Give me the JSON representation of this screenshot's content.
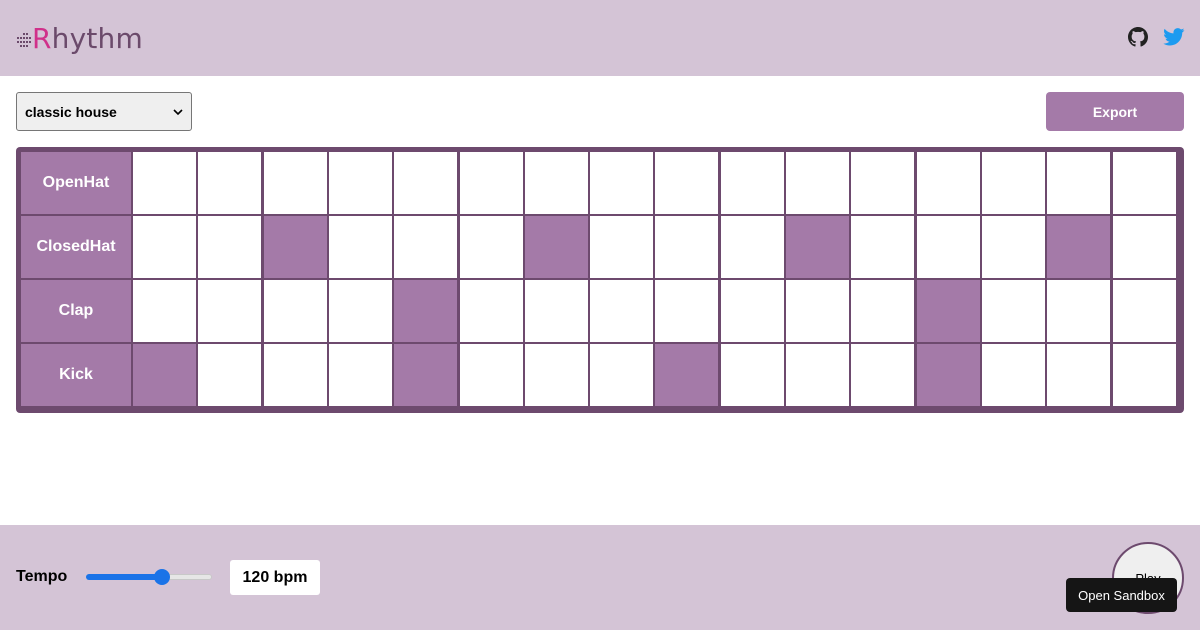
{
  "header": {
    "logo_initial": "R",
    "logo_rest": "hythm",
    "github_icon": "github-icon",
    "twitter_icon": "twitter-icon"
  },
  "toolbar": {
    "preset_selected": "classic house",
    "export_label": "Export"
  },
  "sequencer": {
    "steps": 16,
    "active_color": "#a47aa8",
    "rows": [
      {
        "label": "OpenHat",
        "pattern": [
          0,
          0,
          0,
          0,
          0,
          0,
          0,
          0,
          0,
          0,
          0,
          0,
          0,
          0,
          0,
          0
        ]
      },
      {
        "label": "ClosedHat",
        "pattern": [
          0,
          0,
          1,
          0,
          0,
          0,
          1,
          0,
          0,
          0,
          1,
          0,
          0,
          0,
          1,
          0
        ]
      },
      {
        "label": "Clap",
        "pattern": [
          0,
          0,
          0,
          0,
          1,
          0,
          0,
          0,
          0,
          0,
          0,
          0,
          1,
          0,
          0,
          0
        ]
      },
      {
        "label": "Kick",
        "pattern": [
          1,
          0,
          0,
          0,
          1,
          0,
          0,
          0,
          1,
          0,
          0,
          0,
          1,
          0,
          0,
          0
        ]
      }
    ]
  },
  "footer": {
    "tempo_label": "Tempo",
    "tempo_fraction": 0.6,
    "bpm_display": "120 bpm",
    "play_label": "Play",
    "tooltip": "Open Sandbox"
  }
}
